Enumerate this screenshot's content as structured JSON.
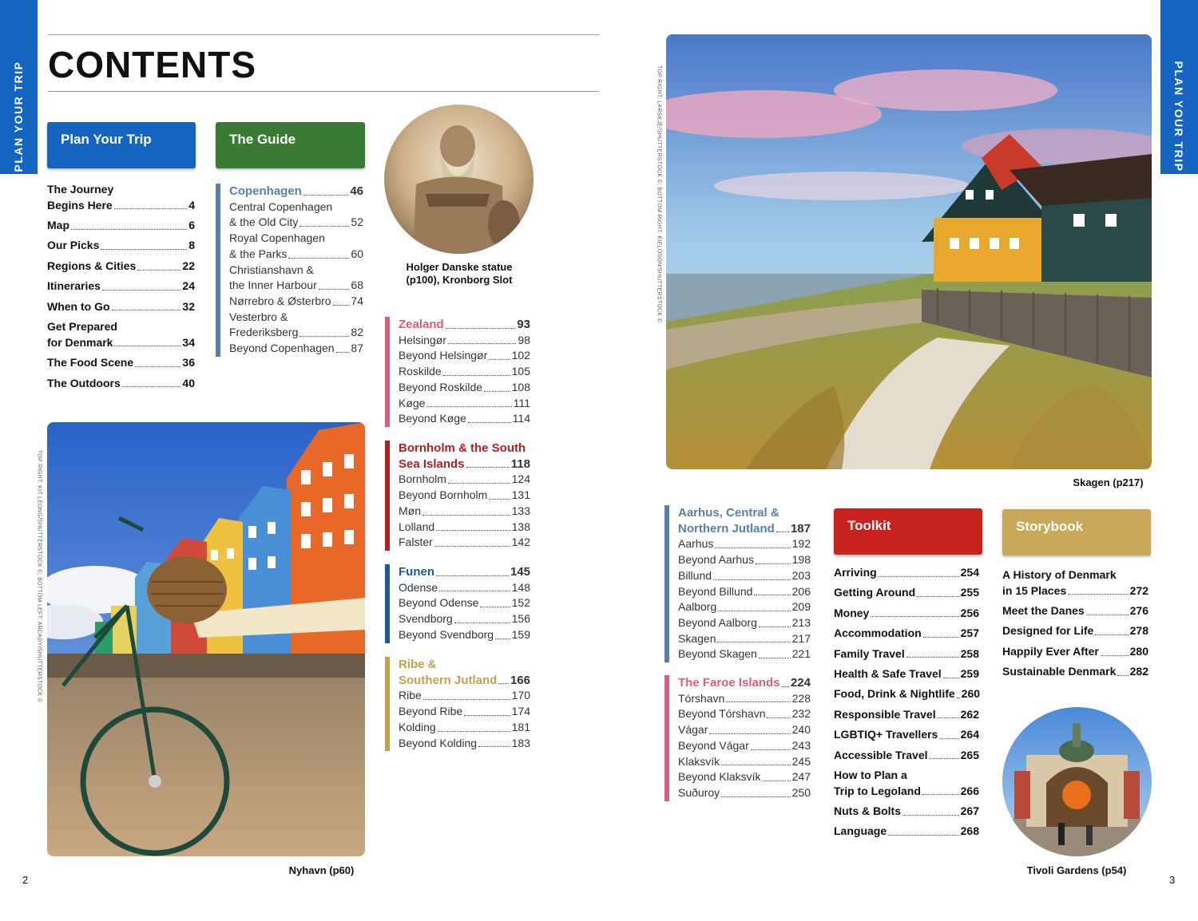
{
  "side_tabs": {
    "left": "PLAN YOUR TRIP",
    "right": "PLAN YOUR TRIP"
  },
  "title": "CONTENTS",
  "headers": {
    "plan": "Plan Your Trip",
    "guide": "The Guide",
    "toolkit": "Toolkit",
    "storybook": "Storybook"
  },
  "colors": {
    "plan": "#1565c0",
    "guide": "#3b7a35",
    "toolkit": "#c8231e",
    "storybook": "#c9a85a",
    "copenhagen": "#5a80a8",
    "zealand": "#d9607a",
    "bornholm": "#b31e24",
    "funen": "#1c5a9e",
    "ribe": "#c4a24a",
    "aarhus": "#5a80a8",
    "faroe": "#d9607a"
  },
  "plan_items": [
    {
      "l1": "The Journey",
      "label": "Begins Here",
      "page": "4"
    },
    {
      "label": "Map",
      "page": "6"
    },
    {
      "label": "Our Picks",
      "page": "8"
    },
    {
      "label": "Regions & Cities",
      "page": "22"
    },
    {
      "label": "Itineraries",
      "page": "24"
    },
    {
      "label": "When to Go",
      "page": "32"
    },
    {
      "l1": "Get Prepared",
      "label": "for Denmark",
      "page": "34"
    },
    {
      "label": "The Food Scene",
      "page": "36"
    },
    {
      "label": "The Outdoors",
      "page": "40"
    }
  ],
  "copenhagen": {
    "head": {
      "label": "Copenhagen",
      "page": "46"
    },
    "items": [
      {
        "l1": "Central Copenhagen",
        "label": "& the Old City",
        "page": "52"
      },
      {
        "l1": "Royal Copenhagen",
        "label": "& the Parks",
        "page": "60"
      },
      {
        "l1": "Christianshavn &",
        "label": "the Inner Harbour",
        "page": "68"
      },
      {
        "label": "Nørrebro & Østerbro",
        "page": "74"
      },
      {
        "l1": "Vesterbro &",
        "label": "Frederiksberg",
        "page": "82"
      },
      {
        "label": "Beyond Copenhagen",
        "page": "87"
      }
    ]
  },
  "zealand": {
    "head": {
      "label": "Zealand",
      "page": "93"
    },
    "items": [
      {
        "label": "Helsingør",
        "page": "98"
      },
      {
        "label": "Beyond Helsingør",
        "page": "102"
      },
      {
        "label": "Roskilde",
        "page": "105"
      },
      {
        "label": "Beyond Roskilde",
        "page": "108"
      },
      {
        "label": "Køge",
        "page": "111"
      },
      {
        "label": "Beyond Køge",
        "page": "114"
      }
    ]
  },
  "bornholm": {
    "head": {
      "l1": "Bornholm & the South",
      "label": "Sea Islands",
      "page": "118"
    },
    "items": [
      {
        "label": "Bornholm",
        "page": "124"
      },
      {
        "label": "Beyond Bornholm",
        "page": "131"
      },
      {
        "label": "Møn",
        "page": "133"
      },
      {
        "label": "Lolland",
        "page": "138"
      },
      {
        "label": "Falster",
        "page": "142"
      }
    ]
  },
  "funen": {
    "head": {
      "label": "Funen",
      "page": "145"
    },
    "items": [
      {
        "label": "Odense",
        "page": "148"
      },
      {
        "label": "Beyond Odense",
        "page": "152"
      },
      {
        "label": "Svendborg",
        "page": "156"
      },
      {
        "label": "Beyond Svendborg",
        "page": "159"
      }
    ]
  },
  "ribe": {
    "head": {
      "l1": "Ribe &",
      "label": "Southern Jutland",
      "page": "166"
    },
    "items": [
      {
        "label": "Ribe",
        "page": "170"
      },
      {
        "label": "Beyond Ribe",
        "page": "174"
      },
      {
        "label": "Kolding",
        "page": "181"
      },
      {
        "label": "Beyond Kolding",
        "page": "183"
      }
    ]
  },
  "aarhus": {
    "head": {
      "l1": "Aarhus, Central &",
      "label": "Northern Jutland",
      "page": "187"
    },
    "items": [
      {
        "label": "Aarhus",
        "page": "192"
      },
      {
        "label": "Beyond Aarhus",
        "page": "198"
      },
      {
        "label": "Billund",
        "page": "203"
      },
      {
        "label": "Beyond Billund",
        "page": "206"
      },
      {
        "label": "Aalborg",
        "page": "209"
      },
      {
        "label": "Beyond Aalborg",
        "page": "213"
      },
      {
        "label": "Skagen",
        "page": "217"
      },
      {
        "label": "Beyond Skagen",
        "page": "221"
      }
    ]
  },
  "faroe": {
    "head": {
      "label": "The Faroe Islands",
      "page": "224"
    },
    "items": [
      {
        "label": "Tórshavn",
        "page": "228"
      },
      {
        "label": "Beyond Tórshavn",
        "page": "232"
      },
      {
        "label": "Vágar",
        "page": "240"
      },
      {
        "label": "Beyond Vágar",
        "page": "243"
      },
      {
        "label": "Klaksvík",
        "page": "245"
      },
      {
        "label": "Beyond Klaksvík",
        "page": "247"
      },
      {
        "label": "Suðuroy",
        "page": "250"
      }
    ]
  },
  "toolkit_items": [
    {
      "label": "Arriving",
      "page": "254"
    },
    {
      "label": "Getting Around",
      "page": "255"
    },
    {
      "label": "Money",
      "page": "256"
    },
    {
      "label": "Accommodation",
      "page": "257"
    },
    {
      "label": "Family Travel",
      "page": "258"
    },
    {
      "label": "Health & Safe Travel",
      "page": "259"
    },
    {
      "label": "Food, Drink & Nightlife",
      "page": "260"
    },
    {
      "label": "Responsible Travel",
      "page": "262"
    },
    {
      "label": "LGBTIQ+ Travellers",
      "page": "264"
    },
    {
      "label": "Accessible Travel",
      "page": "265"
    },
    {
      "l1": "How to Plan a",
      "label": "Trip to Legoland",
      "page": "266"
    },
    {
      "label": "Nuts & Bolts",
      "page": "267"
    },
    {
      "label": "Language",
      "page": "268"
    }
  ],
  "storybook_items": [
    {
      "l1": "A History of Denmark",
      "label": "in 15 Places",
      "page": "272"
    },
    {
      "label": "Meet the Danes",
      "page": "276"
    },
    {
      "label": "Designed for Life",
      "page": "278"
    },
    {
      "label": "Happily Ever After",
      "page": "280"
    },
    {
      "label": "Sustainable Denmark",
      "page": "282"
    }
  ],
  "captions": {
    "holger": "Holger Danske statue (p100), Kronborg Slot",
    "nyhavn": "Nyhavn (p60)",
    "skagen": "Skagen (p217)",
    "tivoli": "Tivoli Gardens (p54)"
  },
  "credits": {
    "left": "TOP RIGHT: KIT LEONG/SHUTTERSTOCK ©; BOTTOM LEFT: ARCADY/SHUTTERSTOCK ©",
    "right": "TOP RIGHT: LARSKJE/SHUTTERSTOCK ©; BOTTOM RIGHT: KIELOSON/SHUTTERSTOCK ©"
  },
  "page_numbers": {
    "left": "2",
    "right": "3"
  }
}
